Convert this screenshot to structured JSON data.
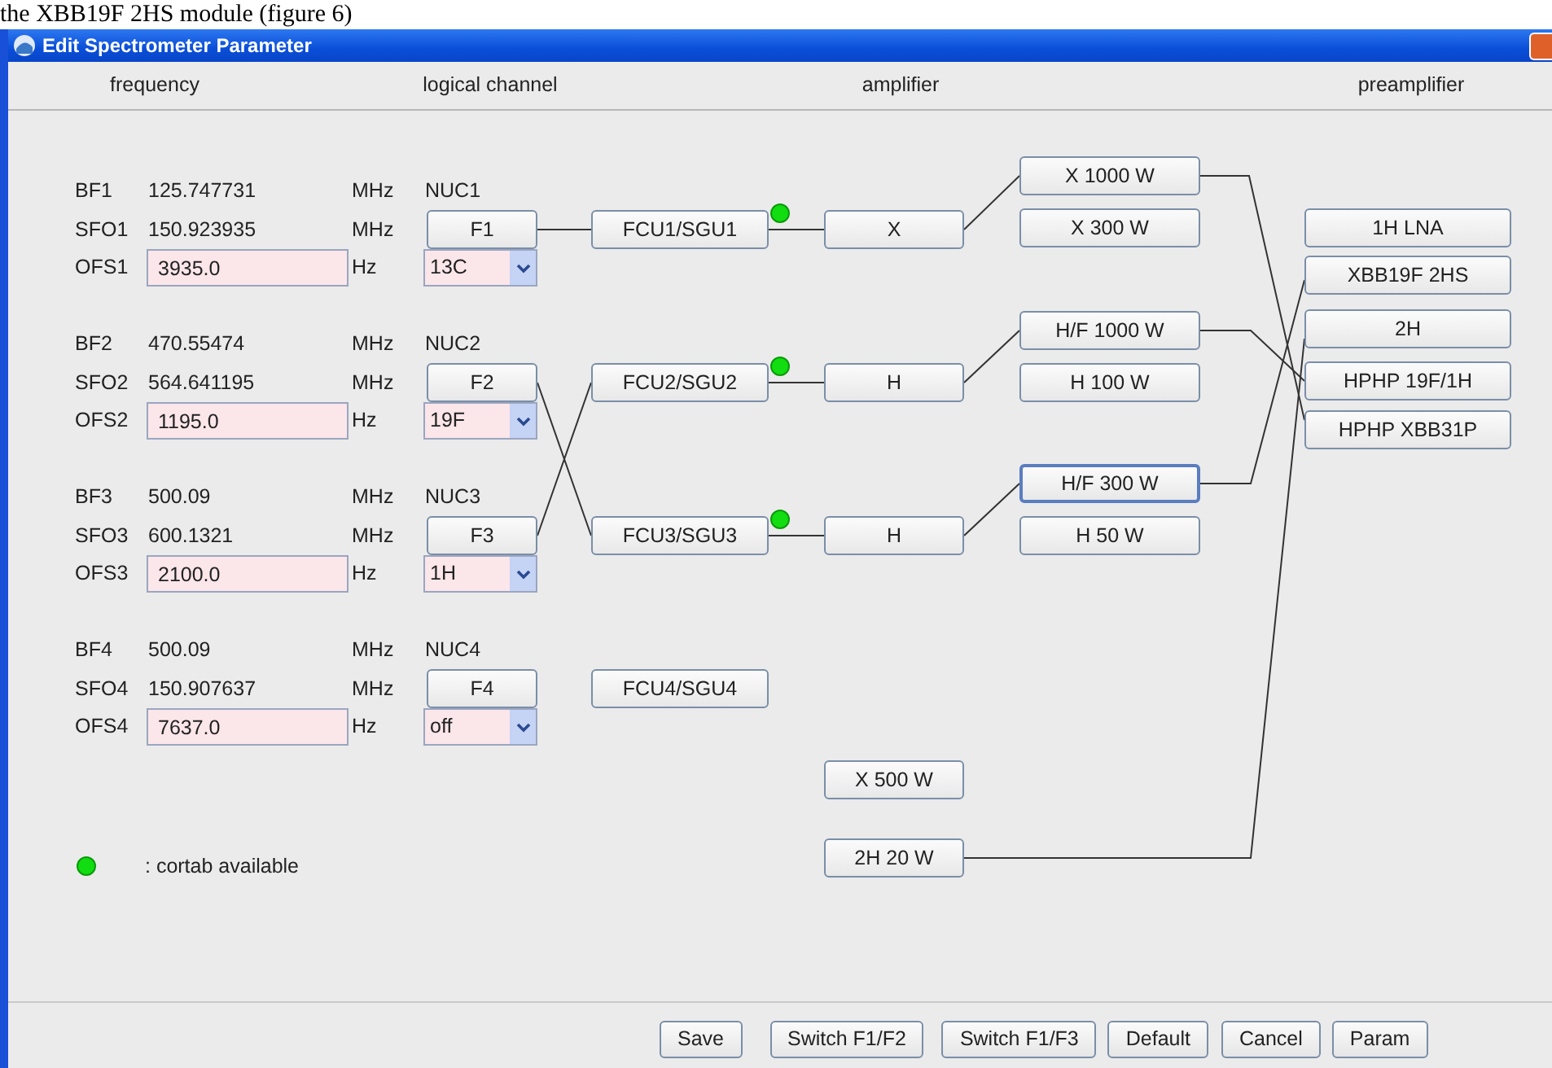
{
  "caption": "the XBB19F 2HS module (figure 6)",
  "window": {
    "title": "Edit Spectrometer Parameter"
  },
  "columns": [
    "frequency",
    "logical channel",
    "amplifier",
    "preamplifier"
  ],
  "channels": [
    {
      "bf_label": "BF1",
      "bf": "125.747731",
      "bf_unit": "MHz",
      "nuc": "NUC1",
      "sfo_label": "SFO1",
      "sfo": "150.923935",
      "sfo_unit": "MHz",
      "f_button": "F1",
      "ofs_label": "OFS1",
      "ofs": "3935.0",
      "ofs_unit": "Hz",
      "nucleus": "13C"
    },
    {
      "bf_label": "BF2",
      "bf": "470.55474",
      "bf_unit": "MHz",
      "nuc": "NUC2",
      "sfo_label": "SFO2",
      "sfo": "564.641195",
      "sfo_unit": "MHz",
      "f_button": "F2",
      "ofs_label": "OFS2",
      "ofs": "1195.0",
      "ofs_unit": "Hz",
      "nucleus": "19F"
    },
    {
      "bf_label": "BF3",
      "bf": "500.09",
      "bf_unit": "MHz",
      "nuc": "NUC3",
      "sfo_label": "SFO3",
      "sfo": "600.1321",
      "sfo_unit": "MHz",
      "f_button": "F3",
      "ofs_label": "OFS3",
      "ofs": "2100.0",
      "ofs_unit": "Hz",
      "nucleus": "1H"
    },
    {
      "bf_label": "BF4",
      "bf": "500.09",
      "bf_unit": "MHz",
      "nuc": "NUC4",
      "sfo_label": "SFO4",
      "sfo": "150.907637",
      "sfo_unit": "MHz",
      "f_button": "F4",
      "ofs_label": "OFS4",
      "ofs": "7637.0",
      "ofs_unit": "Hz",
      "nucleus": "off"
    }
  ],
  "routers": [
    {
      "label": "FCU1/SGU1",
      "cortab": true
    },
    {
      "label": "FCU2/SGU2",
      "cortab": true
    },
    {
      "label": "FCU3/SGU3",
      "cortab": true
    },
    {
      "label": "FCU4/SGU4",
      "cortab": false
    }
  ],
  "amplifiers": [
    {
      "label": "X"
    },
    {
      "label": "H"
    },
    {
      "label": "H"
    }
  ],
  "amp_outputs": [
    {
      "label": "X 1000 W",
      "selected": false
    },
    {
      "label": "X 300 W",
      "selected": false
    },
    {
      "label": "H/F 1000 W",
      "selected": false
    },
    {
      "label": "H 100 W",
      "selected": false
    },
    {
      "label": "H/F 300 W",
      "selected": true
    },
    {
      "label": "H 50 W",
      "selected": false
    },
    {
      "label": "X 500 W",
      "selected": false
    },
    {
      "label": "2H 20 W",
      "selected": false
    }
  ],
  "preamplifiers": [
    {
      "label": "1H LNA"
    },
    {
      "label": "XBB19F 2HS"
    },
    {
      "label": "2H"
    },
    {
      "label": "HPHP 19F/1H"
    },
    {
      "label": "HPHP XBB31P"
    }
  ],
  "legend": {
    "text": ": cortab available"
  },
  "buttons": [
    "Save",
    "Switch F1/F2",
    "Switch F1/F3",
    "Default",
    "Cancel",
    "Param"
  ]
}
